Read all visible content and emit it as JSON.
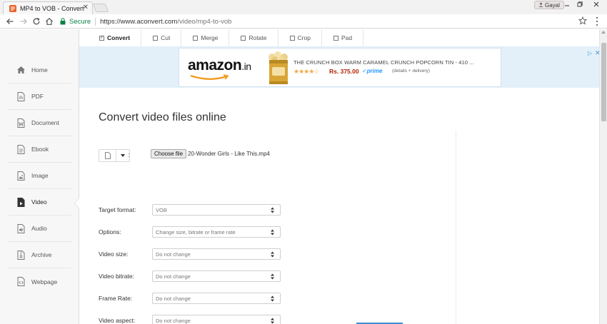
{
  "browser": {
    "tab_title": "MP4 to VOB - Convert vi",
    "profile_name": "Gayal",
    "secure_label": "Secure",
    "url_host": "https://www.aconvert.com",
    "url_path": "/video/mp4-to-vob"
  },
  "sidebar": {
    "items": [
      {
        "label": "Home",
        "icon": "home-icon"
      },
      {
        "label": "PDF",
        "icon": "pdf-file-icon"
      },
      {
        "label": "Document",
        "icon": "word-document-icon"
      },
      {
        "label": "Ebook",
        "icon": "ebook-icon"
      },
      {
        "label": "Image",
        "icon": "image-icon"
      },
      {
        "label": "Video",
        "icon": "video-icon",
        "active": true
      },
      {
        "label": "Audio",
        "icon": "audio-icon"
      },
      {
        "label": "Archive",
        "icon": "archive-icon"
      },
      {
        "label": "Webpage",
        "icon": "webpage-icon"
      }
    ]
  },
  "toolnav": {
    "items": [
      {
        "label": "Convert",
        "checked": true
      },
      {
        "label": "Cut",
        "checked": false
      },
      {
        "label": "Merge",
        "checked": false
      },
      {
        "label": "Rotate",
        "checked": false
      },
      {
        "label": "Crop",
        "checked": false
      },
      {
        "label": "Pad",
        "checked": false
      }
    ]
  },
  "ad": {
    "brand": "amazon",
    "brand_suffix": ".in",
    "title": "THE CRUNCH BOX WARM CARAMEL CRUNCH POPCORN TIN - 410 ...",
    "stars": "★★★★☆",
    "price": "Rs. 375.00",
    "prime": "✓prime",
    "delivery": "(details + delivery)"
  },
  "main": {
    "heading": "Convert video files online",
    "choose_file_label": "Choose file",
    "file_name": "20-Wonder Girls - Like This.mp4",
    "colon": ":",
    "fields": [
      {
        "label": "Target format:",
        "value": "VOB"
      },
      {
        "label": "Options:",
        "value": "Change size, bitrate or frame rate"
      },
      {
        "label": "Video size:",
        "value": "Do not change"
      },
      {
        "label": "Video bitrate:",
        "value": "Do not change"
      },
      {
        "label": "Frame Rate:",
        "value": "Do not change"
      },
      {
        "label": "Video aspect:",
        "value": "Do not change"
      }
    ]
  },
  "colors": {
    "accent": "#3c8fd3",
    "secure": "#0b8043",
    "ad_background": "#e3f0fa",
    "sidebar_background": "#f7f7f7"
  }
}
